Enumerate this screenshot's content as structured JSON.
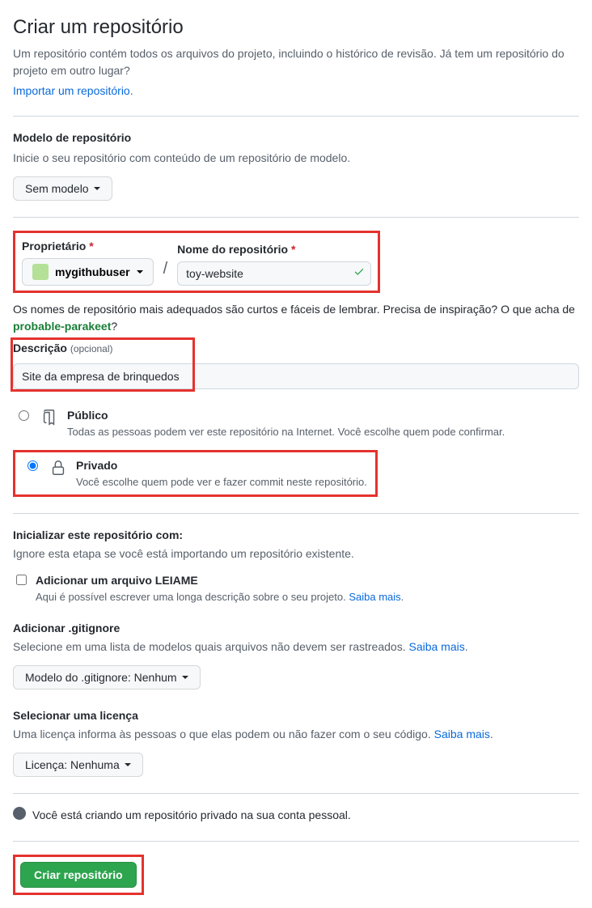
{
  "header": {
    "title": "Criar um repositório",
    "subtitle": "Um repositório contém todos os arquivos do projeto, incluindo o histórico de revisão. Já tem um repositório do projeto em outro lugar?",
    "import_link": "Importar um repositório"
  },
  "template": {
    "label": "Modelo de repositório",
    "help": "Inicie o seu repositório com conteúdo de um repositório de modelo.",
    "selected": "Sem modelo"
  },
  "owner": {
    "label": "Proprietário",
    "value": "mygithubuser"
  },
  "repo_name": {
    "label": "Nome do repositório",
    "value": "toy-website"
  },
  "name_help": {
    "prefix": "Os nomes de repositório mais adequados são curtos e fáceis de lembrar. Precisa de inspiração? O que acha de ",
    "suggestion": "probable-parakeet",
    "suffix": "?"
  },
  "description": {
    "label": "Descrição",
    "optional": "(opcional)",
    "value": "Site da empresa de brinquedos"
  },
  "visibility": {
    "public": {
      "title": "Público",
      "desc": "Todas as pessoas podem ver este repositório na Internet. Você escolhe quem pode confirmar."
    },
    "private": {
      "title": "Privado",
      "desc": "Você escolhe quem pode ver e fazer commit neste repositório."
    }
  },
  "initialize": {
    "heading": "Inicializar este repositório com:",
    "help": "Ignore esta etapa se você está importando um repositório existente."
  },
  "readme": {
    "title": "Adicionar um arquivo LEIAME",
    "desc": "Aqui é possível escrever uma longa descrição sobre o seu projeto. ",
    "learn_more": "Saiba mais"
  },
  "gitignore": {
    "title": "Adicionar .gitignore",
    "desc": "Selecione em uma lista de modelos quais arquivos não devem ser rastreados. ",
    "learn_more": "Saiba mais",
    "selected_prefix": "Modelo do .gitignore: ",
    "selected_value": "Nenhum"
  },
  "license": {
    "title": "Selecionar uma licença",
    "desc": "Uma licença informa às pessoas o que elas podem ou não fazer com o seu código. ",
    "learn_more": "Saiba mais",
    "selected_prefix": "Licença: ",
    "selected_value": "Nenhuma"
  },
  "footer_info": "Você está criando um repositório privado na sua conta pessoal.",
  "submit": "Criar repositório"
}
